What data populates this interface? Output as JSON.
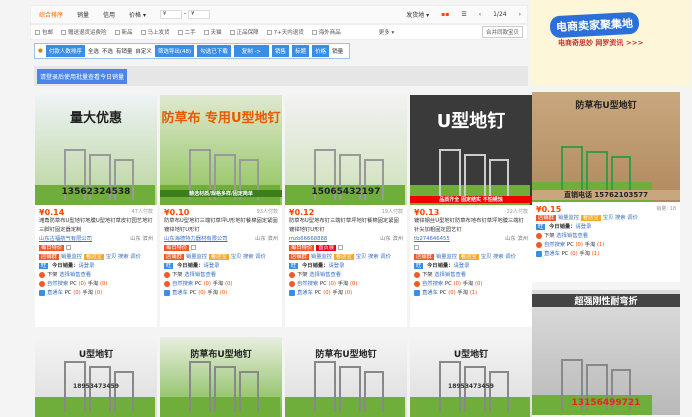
{
  "toolbar": {
    "sort_default": "综合排序",
    "sort_sales": "销量",
    "sort_credit": "信用",
    "price": "价格 ▾",
    "price_min": "¥",
    "price_max": "¥",
    "ship_from": "发货地 ▾",
    "page": "1/24",
    "prev": "‹",
    "next": "›"
  },
  "filters": {
    "items": [
      "包邮",
      "赠送退货运费险",
      "新品",
      "马上发货",
      "二手",
      "天猫",
      "正品保障",
      "7+天内退货",
      "海外商品"
    ],
    "more": "更多 ▾",
    "merge": "合并同款宝贝"
  },
  "plugin": {
    "buyers": "付款人数排序",
    "all": "全选",
    "none": "不选",
    "has_sales": "有销量",
    "custom": "自定义",
    "export": "筛选导出(48)",
    "check_export": "勾选已下载",
    "copy": "复制 ->",
    "f1": "销售",
    "f2": "标题",
    "f3": "价格",
    "f4": "销量"
  },
  "login_btn": "请登录后使用批量查看今日销量",
  "ad": {
    "title": "电商卖家聚集地",
    "sub": "电商奇思妙 网罗资讯 >>>"
  },
  "row_labels": {
    "shop_group": "店铺群",
    "sales_monitor": "销量监控",
    "store_tool": "看店宝",
    "baby": "宝贝",
    "search": "搜索",
    "price_adj": "调价",
    "wang": "旺",
    "today_sales": "今日销量：",
    "login": "请登录",
    "offline": "下架",
    "select_view": "选择销售查看",
    "natural": "自然搜索",
    "direct": "直通车",
    "pc": "PC",
    "mobile": "手淘",
    "hot": "每日特价",
    "new": "首页展"
  },
  "cards": [
    {
      "img_text": "量大优惠",
      "img_sub": "13562324538",
      "price": "¥0.14",
      "sold": "47人付款",
      "title": "滩角防草布U型地钉地膜U型地钉草皮钉园艺地钉三脚钉固定器定制",
      "shop": "山东古福航气有限公司",
      "loc": "山东 滨州",
      "pc": "(0)",
      "mob": "(0)",
      "dpc": "(0)",
      "dmob": "(0)"
    },
    {
      "img_text": "防草布 专用U型地钉",
      "img_sub": "精选材质/规格多样/固定简单",
      "price": "¥0.10",
      "sold": "93人付款",
      "title": "防草布U型地钉三端钉草坪U形地钉餐棉固定紧固镀锌地钉U形钉",
      "shop": "山东海德特力器材有限公司",
      "loc": "山东 滨州",
      "pc": "(0)",
      "mob": "(0)",
      "dpc": "(0)",
      "dmob": "(0)"
    },
    {
      "img_text": "",
      "img_sub": "15065432197",
      "price": "¥0.12",
      "sold": "19人付款",
      "title": "防草布U型地布钉三端钉草坪地钉餐棉固定紧固镀锌地钉U形钉",
      "shop": "mzb66668888",
      "loc": "山东 滨州",
      "pc": "(0)",
      "mob": "(0)",
      "dpc": "(0)",
      "dmob": "(0)"
    },
    {
      "img_text": "U型地钉",
      "img_sub": "品质齐全  固定结实  不怕锈蚀",
      "price": "¥0.13",
      "sold": "22人付款",
      "title": "镀锌钢丝U型地钉防草布地布钉草坪地膜三端钉针尖加粗固定园艺钉",
      "shop": "tb274646455",
      "loc": "山东 滨州",
      "pc": "(0)",
      "mob": "(0)",
      "dpc": "(0)",
      "dmob": "(1)"
    }
  ],
  "side_card": {
    "img_text": "防草布U型地钉",
    "img_sub": "直销电话 15762103577",
    "price": "¥0.15",
    "sold": "销量: 18",
    "pc": "(0)",
    "mob": "(1)",
    "dpc": "(0)",
    "dmob": "(1)"
  },
  "row2": [
    {
      "t": "U型地钉",
      "s": "18953473459"
    },
    {
      "t": "防草布U型地钉",
      "s": ""
    },
    {
      "t": "防草布U型地钉",
      "s": ""
    },
    {
      "t": "U型地钉",
      "s": "18953473459"
    },
    {
      "t": "超强刚性耐弯折",
      "s": "13156499721"
    }
  ]
}
